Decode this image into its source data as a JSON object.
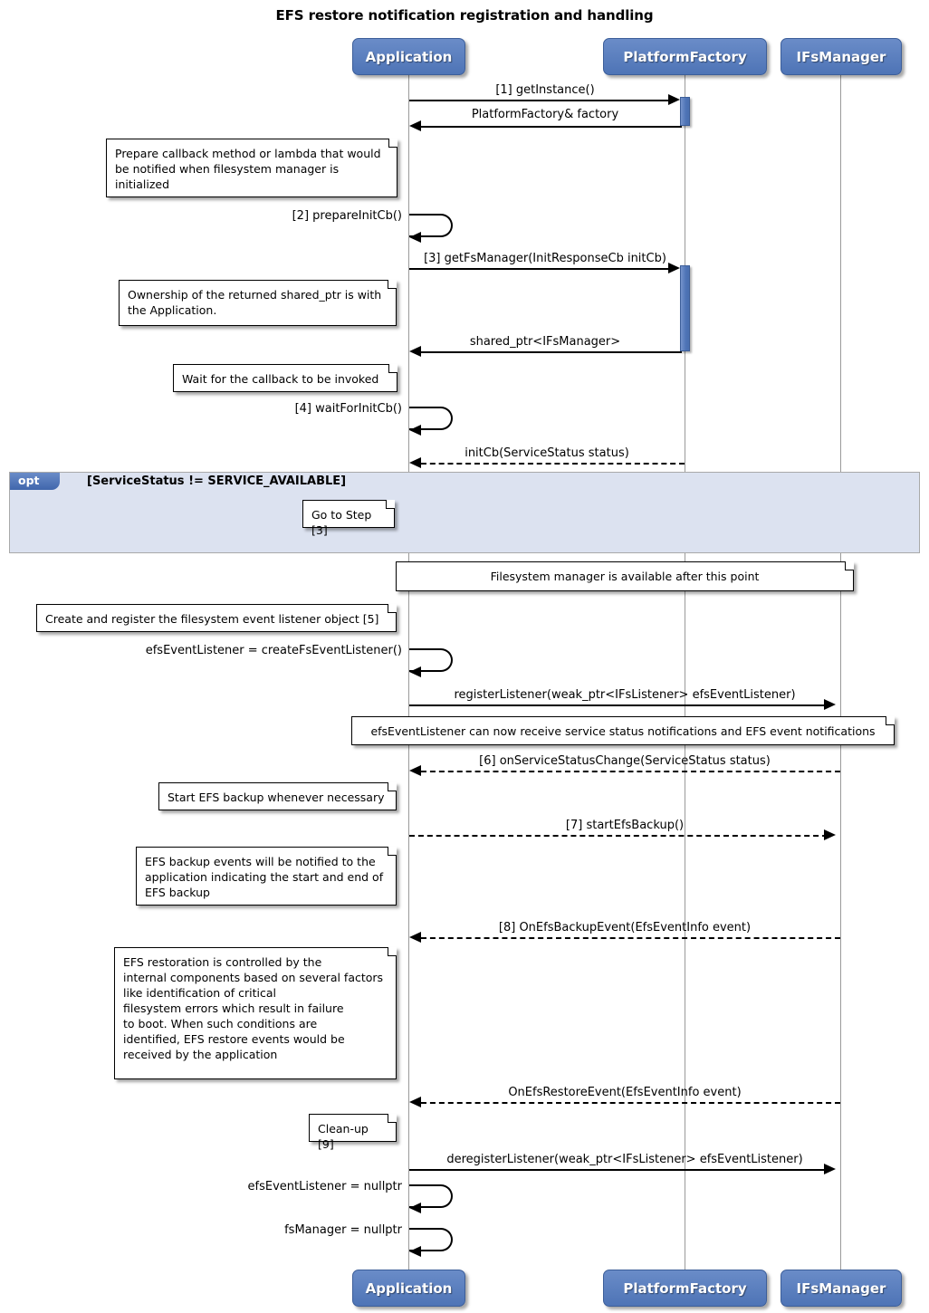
{
  "title": "EFS restore notification registration and handling",
  "colors": {
    "participant_fill": "#5B81C0",
    "participant_border": "#3C5E99",
    "fragment_fill": "#DCE2F0",
    "fragment_border": "#A9A9A9",
    "lifeline": "#808080",
    "text": "#000000"
  },
  "participants": [
    {
      "id": "application",
      "label": "Application"
    },
    {
      "id": "platformfactory",
      "label": "PlatformFactory"
    },
    {
      "id": "ifsmanager",
      "label": "IFsManager"
    }
  ],
  "participants_footer": [
    {
      "id": "application",
      "label": "Application"
    },
    {
      "id": "platformfactory",
      "label": "PlatformFactory"
    },
    {
      "id": "ifsmanager",
      "label": "IFsManager"
    }
  ],
  "messages": [
    {
      "id": "m1",
      "label": "[1] getInstance()",
      "from": "application",
      "to": "platformfactory",
      "style": "solid",
      "direction": "right"
    },
    {
      "id": "m2",
      "label": "PlatformFactory& factory",
      "from": "platformfactory",
      "to": "application",
      "style": "solid",
      "direction": "left"
    },
    {
      "id": "m3",
      "label": "[2] prepareInitCb()",
      "from": "application",
      "to": "application",
      "style": "solid",
      "direction": "self"
    },
    {
      "id": "m4",
      "label": "[3] getFsManager(InitResponseCb initCb)",
      "from": "application",
      "to": "platformfactory",
      "style": "solid",
      "direction": "right"
    },
    {
      "id": "m5",
      "label": "shared_ptr<IFsManager>",
      "from": "platformfactory",
      "to": "application",
      "style": "solid",
      "direction": "left"
    },
    {
      "id": "m6",
      "label": "[4] waitForInitCb()",
      "from": "application",
      "to": "application",
      "style": "solid",
      "direction": "self"
    },
    {
      "id": "m7",
      "label": "initCb(ServiceStatus status)",
      "from": "platformfactory",
      "to": "application",
      "style": "dashed",
      "direction": "left"
    },
    {
      "id": "m8",
      "label": "efsEventListener = createFsEventListener()",
      "from": "application",
      "to": "application",
      "style": "solid",
      "direction": "self"
    },
    {
      "id": "m9",
      "label": "registerListener(weak_ptr<IFsListener> efsEventListener)",
      "from": "application",
      "to": "ifsmanager",
      "style": "solid",
      "direction": "right"
    },
    {
      "id": "m10",
      "label": "[6] onServiceStatusChange(ServiceStatus status)",
      "from": "ifsmanager",
      "to": "application",
      "style": "dashed",
      "direction": "left"
    },
    {
      "id": "m11",
      "label": "[7] startEfsBackup()",
      "from": "application",
      "to": "ifsmanager",
      "style": "dashed",
      "direction": "right"
    },
    {
      "id": "m12",
      "label": "[8] OnEfsBackupEvent(EfsEventInfo event)",
      "from": "ifsmanager",
      "to": "application",
      "style": "dashed",
      "direction": "left"
    },
    {
      "id": "m13",
      "label": "OnEfsRestoreEvent(EfsEventInfo event)",
      "from": "ifsmanager",
      "to": "application",
      "style": "dashed",
      "direction": "left"
    },
    {
      "id": "m14",
      "label": "deregisterListener(weak_ptr<IFsListener> efsEventListener)",
      "from": "application",
      "to": "ifsmanager",
      "style": "solid",
      "direction": "right"
    },
    {
      "id": "m15",
      "label": "efsEventListener = nullptr",
      "from": "application",
      "to": "application",
      "style": "solid",
      "direction": "self"
    },
    {
      "id": "m16",
      "label": "fsManager = nullptr",
      "from": "application",
      "to": "application",
      "style": "solid",
      "direction": "self"
    }
  ],
  "notes": [
    {
      "id": "n1",
      "text": "Prepare callback method or lambda that would\nbe notified when filesystem manager is\ninitialized"
    },
    {
      "id": "n2",
      "text": "Ownership of the returned shared_ptr is with\nthe Application."
    },
    {
      "id": "n3",
      "text": "Wait for the callback to be invoked"
    },
    {
      "id": "n4",
      "text": "Go to Step [3]"
    },
    {
      "id": "n5",
      "text": "Filesystem manager is available after this point"
    },
    {
      "id": "n6",
      "text": "Create and register the filesystem event listener object [5]"
    },
    {
      "id": "n7",
      "text": "efsEventListener can now receive service status notifications and EFS event notifications"
    },
    {
      "id": "n8",
      "text": "Start EFS backup whenever necessary"
    },
    {
      "id": "n9",
      "text": "EFS backup events will be notified to the\napplication indicating the start and end of\nEFS backup"
    },
    {
      "id": "n10",
      "text": "EFS restoration is controlled by the\ninternal components based on several factors\nlike identification of critical\nfilesystem errors which result in failure\nto boot. When such conditions are\nidentified, EFS restore events would be\nreceived by the application"
    },
    {
      "id": "n11",
      "text": "Clean-up [9]"
    }
  ],
  "fragments": [
    {
      "id": "opt1",
      "operator": "opt",
      "guard": "[ServiceStatus != SERVICE_AVAILABLE]"
    }
  ]
}
